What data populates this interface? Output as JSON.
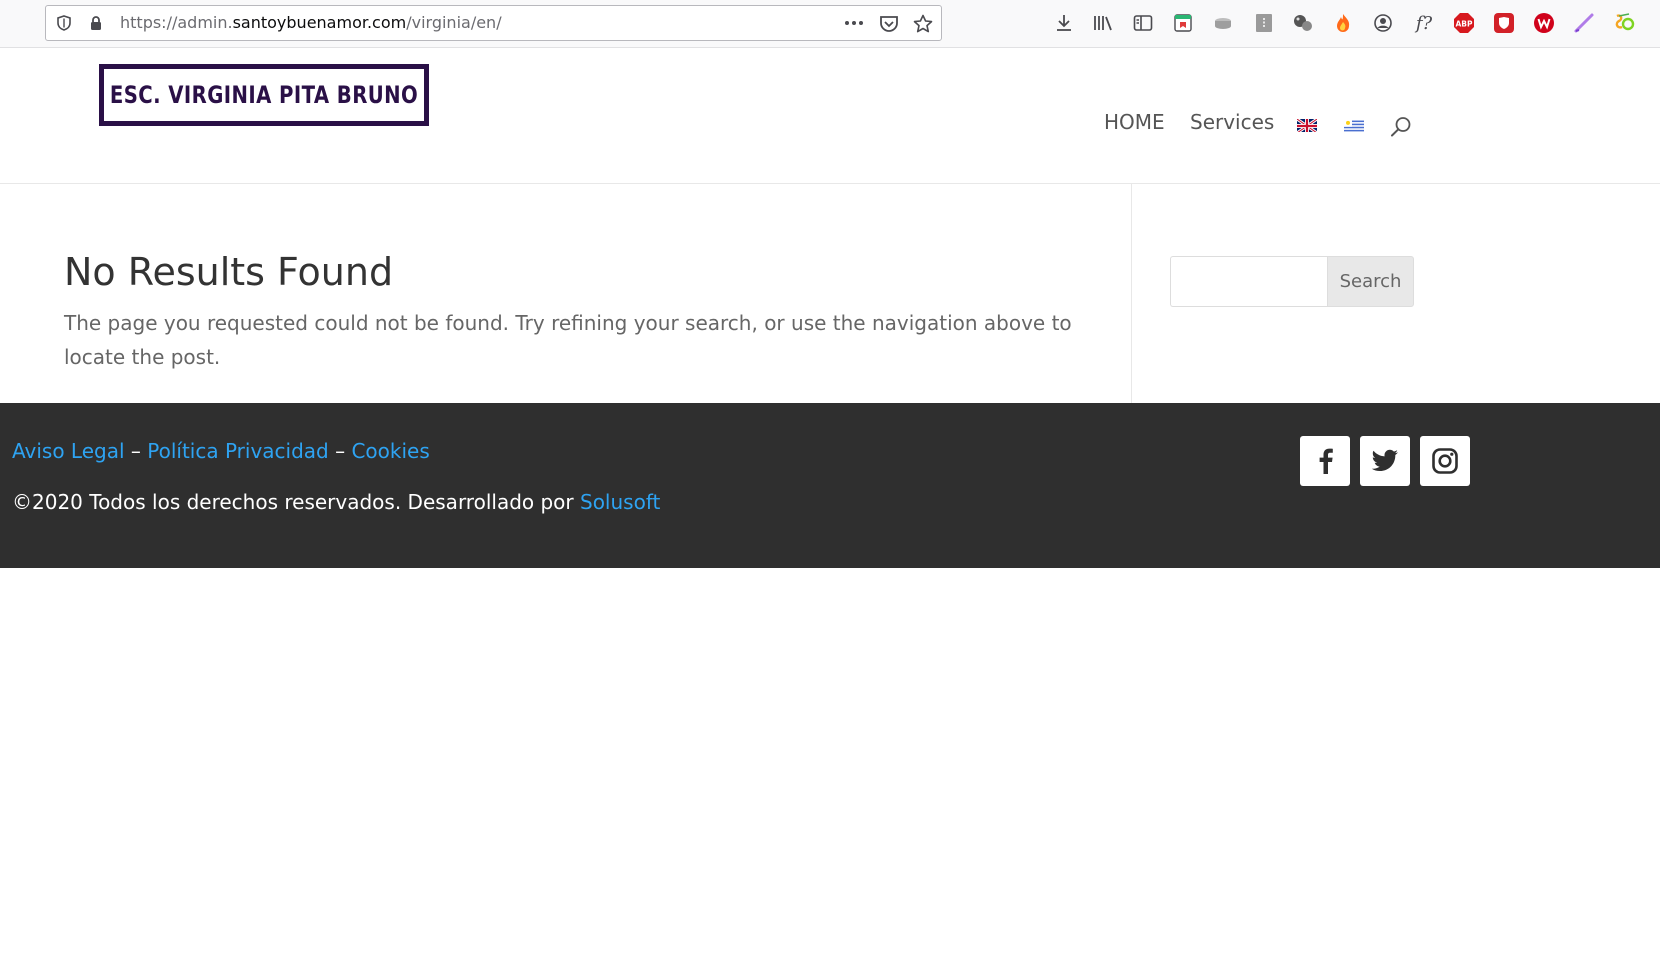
{
  "browser": {
    "url_prefix": "https://admin.",
    "url_domain": "santoybuenamor.com",
    "url_path": "/virginia/en/",
    "extension_labels": {
      "abp": "ABP",
      "fx": "f?"
    }
  },
  "header": {
    "logo_text": "ESC. VIRGINIA PITA BRUNO",
    "nav": {
      "home": "HOME",
      "services": "Services"
    }
  },
  "main": {
    "title": "No Results Found",
    "message": "The page you requested could not be found. Try refining your search, or use the navigation above to locate the post."
  },
  "sidebar": {
    "search_placeholder": "",
    "search_button": "Search"
  },
  "footer": {
    "links": {
      "legal": "Aviso Legal",
      "separator": "–",
      "privacy": "Política Privacidad",
      "cookies": "Cookies"
    },
    "credits_text": "©2020 Todos los derechos reservados. Desarrollado por",
    "credits_link": "Solusoft"
  },
  "colors": {
    "logo_border": "#2a1047",
    "link_blue": "#2ea3f2",
    "footer_bg": "#2f2f2f"
  }
}
